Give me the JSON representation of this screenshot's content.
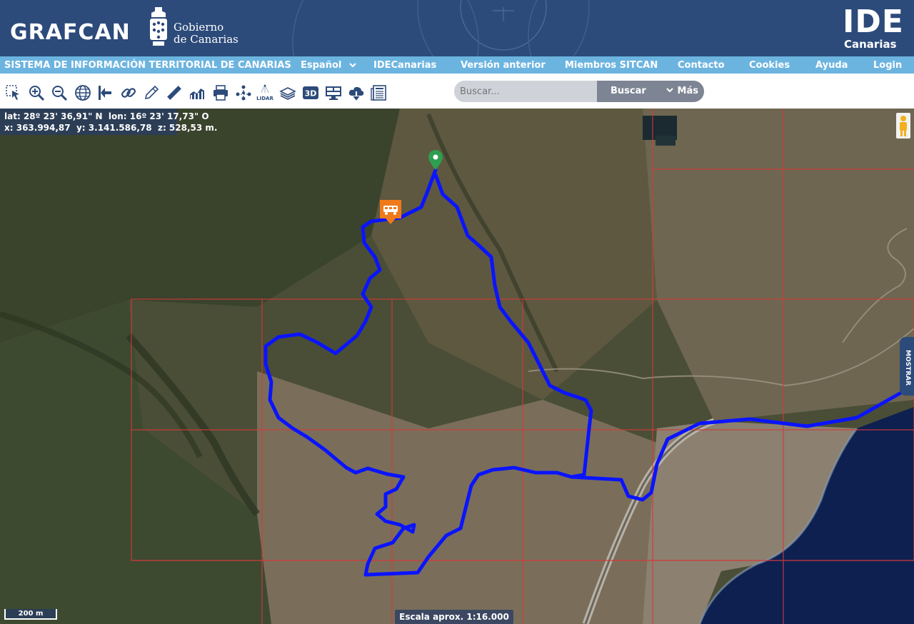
{
  "header": {
    "brand": "GRAFCAN",
    "gobierno_line1": "Gobierno",
    "gobierno_line2": "de Canarias",
    "ide_big": "IDE",
    "ide_small": "Canarias"
  },
  "nav": {
    "site_title": "SISTEMA DE INFORMACIÓN TERRITORIAL DE CANARIAS",
    "language": "Español",
    "items": [
      "IDECanarias",
      "Versión anterior",
      "Miembros SITCAN",
      "Contacto",
      "Cookies",
      "Ayuda",
      "Login"
    ]
  },
  "toolbar": {
    "tools": [
      "select-icon",
      "zoom-in-icon",
      "zoom-out-icon",
      "globe-icon",
      "exit-icon",
      "link-icon",
      "pencil-icon",
      "ruler-icon",
      "profile-chart-icon",
      "print-icon",
      "network-icon",
      "lidar-icon",
      "layers-icon",
      "3d-icon",
      "monitor-icon",
      "download-cloud-icon",
      "news-icon"
    ],
    "lidar_label": "LIDAR",
    "threed_label": "3D",
    "search_placeholder": "Buscar...",
    "search_button": "Buscar",
    "more_button": "Más"
  },
  "map": {
    "coords_line1": "lat: 28º 23' 36,91\" N  lon: 16º 23' 17,73\" O",
    "coords_line2": "x: 363.994,87  y: 3.141.586,78  z: 528,53 m.",
    "scale_bar": "200 m",
    "scale_approx": "Escala aprox. 1:16.000",
    "side_panel": "MOSTRAR",
    "route_color": "#0a14ff",
    "grid_color": "#d43a3a",
    "marker_color": "#2e9e50",
    "bus_marker_color": "#f07a1a"
  }
}
